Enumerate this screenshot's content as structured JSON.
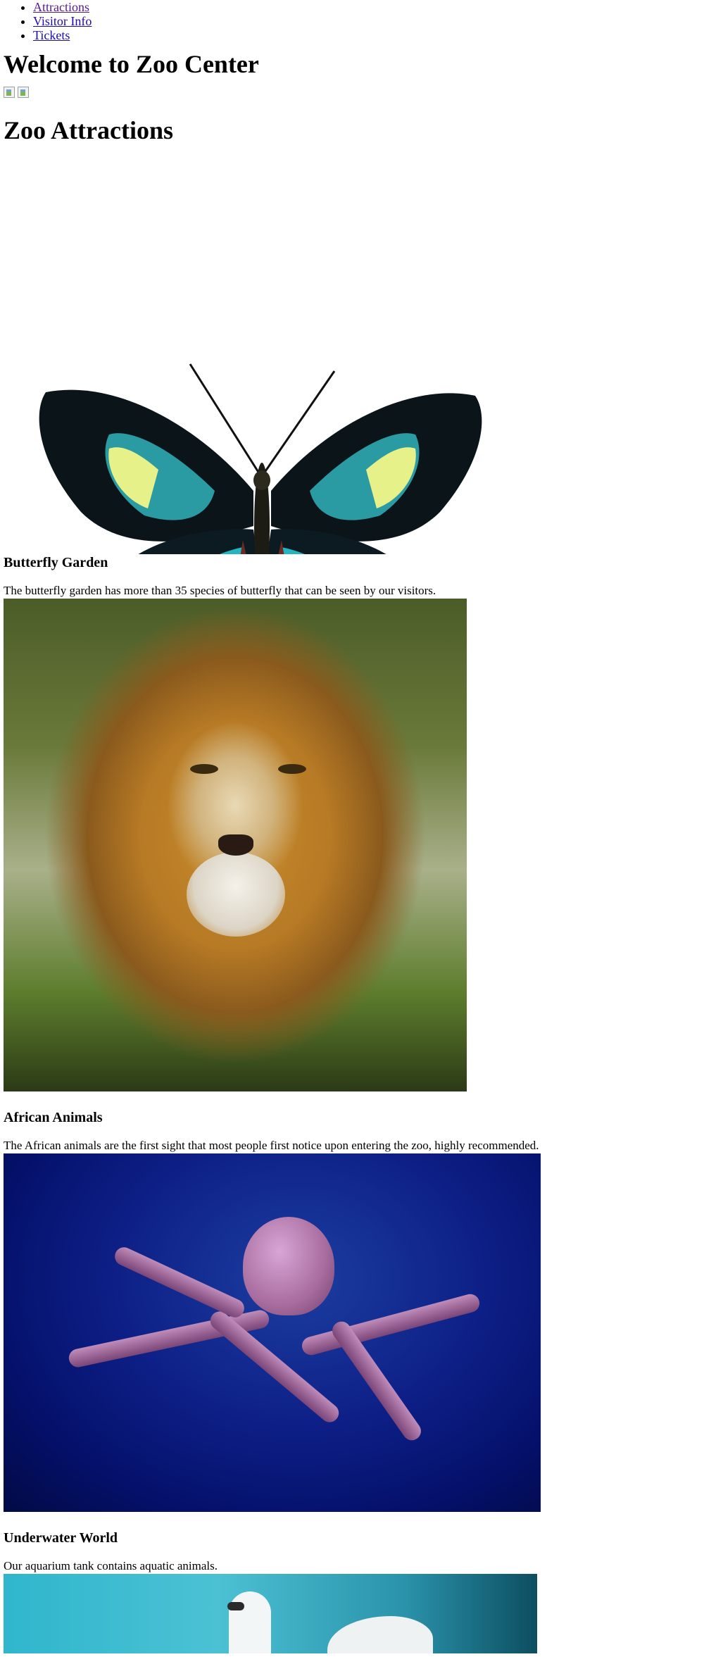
{
  "nav": {
    "items": [
      {
        "label": "Attractions"
      },
      {
        "label": "Visitor Info"
      },
      {
        "label": "Tickets"
      }
    ]
  },
  "page_title": "Welcome to Zoo Center",
  "section_title": "Zoo Attractions",
  "attractions": [
    {
      "name": "Butterfly Garden",
      "description": "The butterfly garden has more than 35 species of butterfly that can be seen by our visitors.",
      "image": "butterfly"
    },
    {
      "name": "African Animals",
      "description": "The African animals are the first sight that most people first notice upon entering the zoo, highly recommended.",
      "image": "lion"
    },
    {
      "name": "Underwater World",
      "description": "Our aquarium tank contains aquatic animals.",
      "image": "octopus"
    },
    {
      "image": "swan"
    }
  ],
  "colors": {
    "link": "#1a0dab",
    "visited_link": "#551a8b"
  }
}
